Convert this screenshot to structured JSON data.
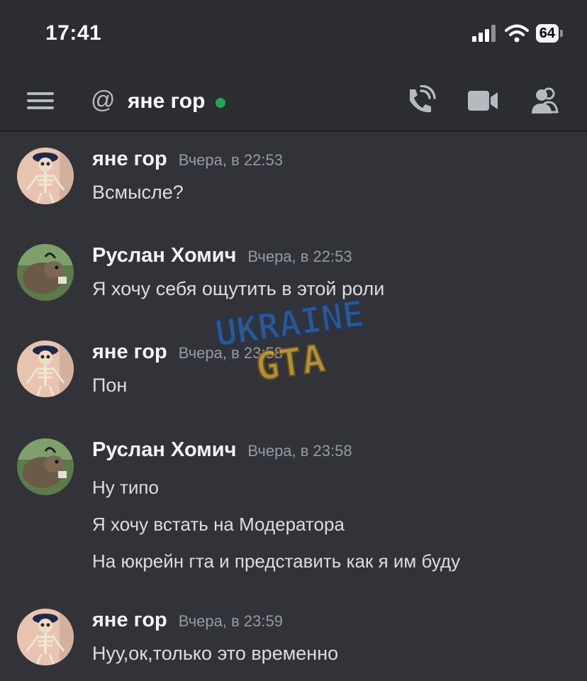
{
  "status_bar": {
    "time": "17:41",
    "battery": "64"
  },
  "header": {
    "title": "яне гор"
  },
  "watermark": {
    "line1": "UKRAINE",
    "line2": "GTA"
  },
  "messages": [
    {
      "author": "яне гор",
      "timestamp": "Вчера, в 22:53",
      "lines": [
        "Всмысле?"
      ]
    },
    {
      "author": "Руслан Хомич",
      "timestamp": "Вчера, в 22:53",
      "lines": [
        "Я хочу себя ощутить в этой роли"
      ]
    },
    {
      "author": "яне гор",
      "timestamp": "Вчера, в 23:58",
      "lines": [
        "Пон"
      ]
    },
    {
      "author": "Руслан Хомич",
      "timestamp": "Вчера, в 23:58",
      "lines": [
        "Ну типо",
        "Я хочу встать на Модератора",
        "На юкрейн гта и представить как я им буду"
      ]
    },
    {
      "author": "яне гор",
      "timestamp": "Вчера, в 23:59",
      "lines": [
        "Нуу,ок,только это временно"
      ]
    }
  ]
}
